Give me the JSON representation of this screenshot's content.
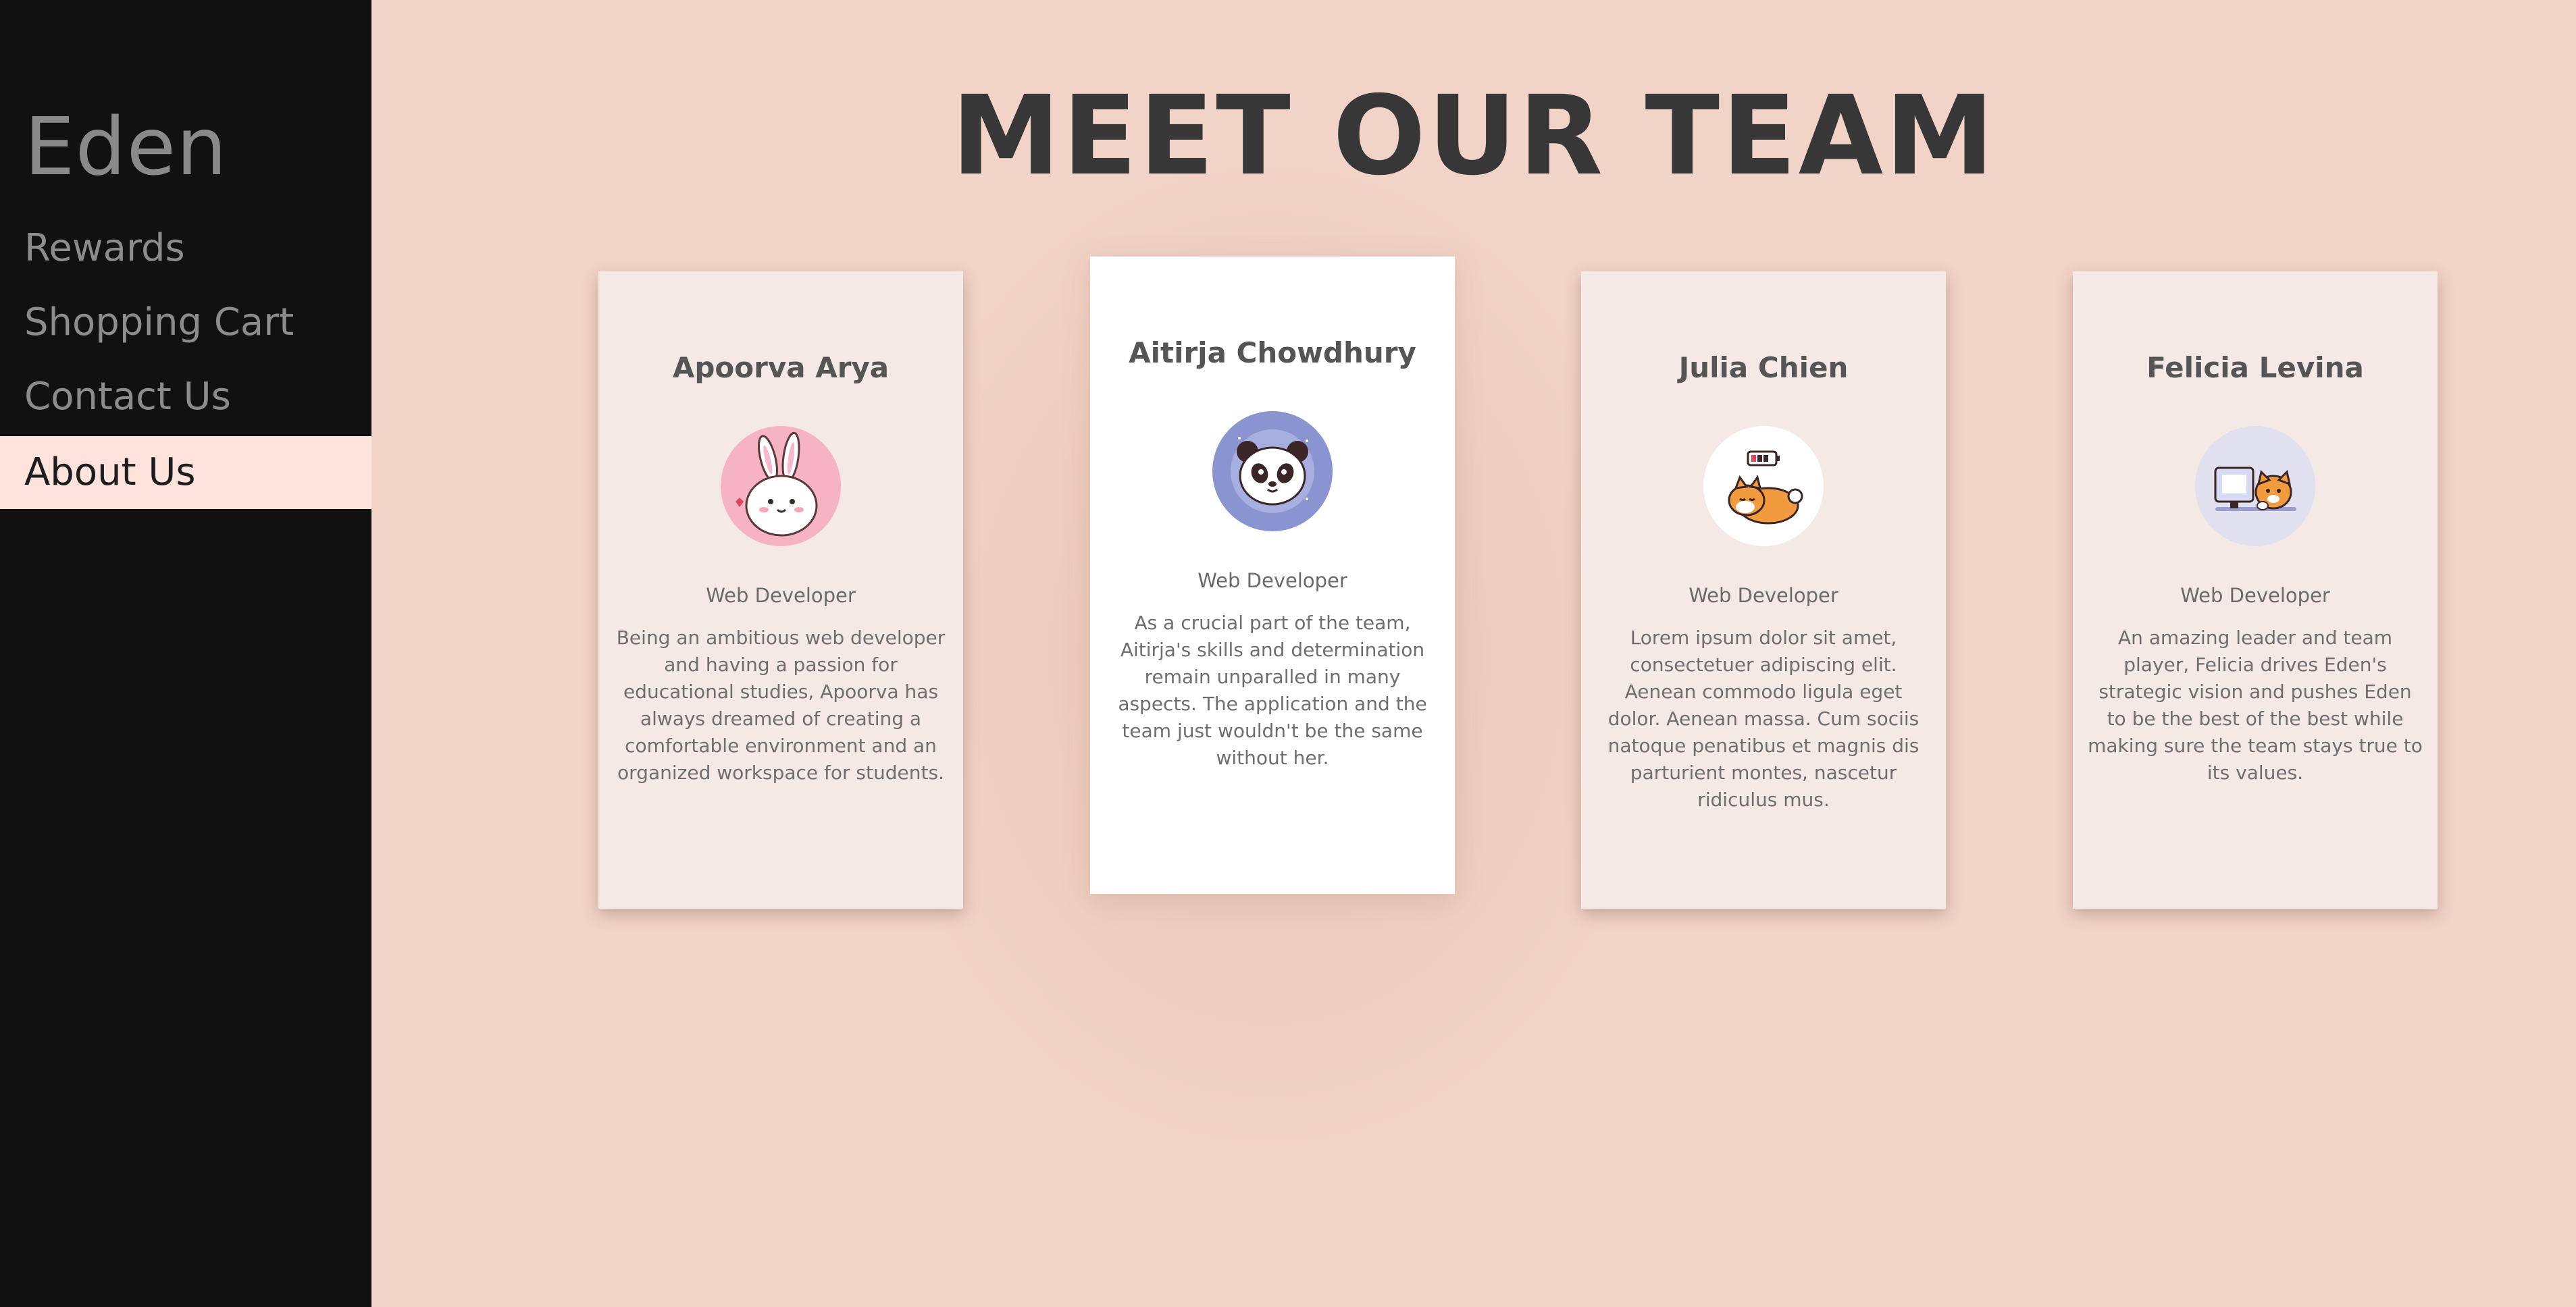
{
  "sidebar": {
    "brand": "Eden",
    "items": [
      {
        "label": "Rewards",
        "active": false
      },
      {
        "label": "Shopping Cart",
        "active": false
      },
      {
        "label": "Contact Us",
        "active": false
      },
      {
        "label": "About Us",
        "active": true
      }
    ]
  },
  "main": {
    "title": "MEET OUR TEAM",
    "members": [
      {
        "name": "Apoorva Arya",
        "avatar_icon": "bunny-icon",
        "role": "Web Developer",
        "bio": "Being an ambitious web developer and having a passion for educational studies, Apoorva has always dreamed of creating a comfortable environment and an organized workspace for students."
      },
      {
        "name": "Aitirja Chowdhury",
        "avatar_icon": "panda-icon",
        "role": "Web Developer",
        "bio": "As a crucial part of the team, Aitirja's skills and determination remain unparalled in many aspects. The application and the team just wouldn't be the same without her."
      },
      {
        "name": "Julia Chien",
        "avatar_icon": "shiba-dog-icon",
        "role": "Web Developer",
        "bio": "Lorem ipsum dolor sit amet, consectetuer adipiscing elit. Aenean commodo ligula eget dolor. Aenean massa. Cum sociis natoque penatibus et magnis dis parturient montes, nascetur ridiculus mus."
      },
      {
        "name": "Felicia Levina",
        "avatar_icon": "cat-computer-icon",
        "role": "Web Developer",
        "bio": "An amazing leader and team player, Felicia drives Eden's strategic vision and pushes Eden to be the best of the best while making sure the team stays true to its values."
      }
    ]
  },
  "colors": {
    "sidebar_bg": "#111111",
    "page_bg": "#f2d3c7",
    "active_nav_bg": "#fde3dc",
    "card_bg": "#f5e9e5",
    "featured_card_bg": "#ffffff"
  }
}
